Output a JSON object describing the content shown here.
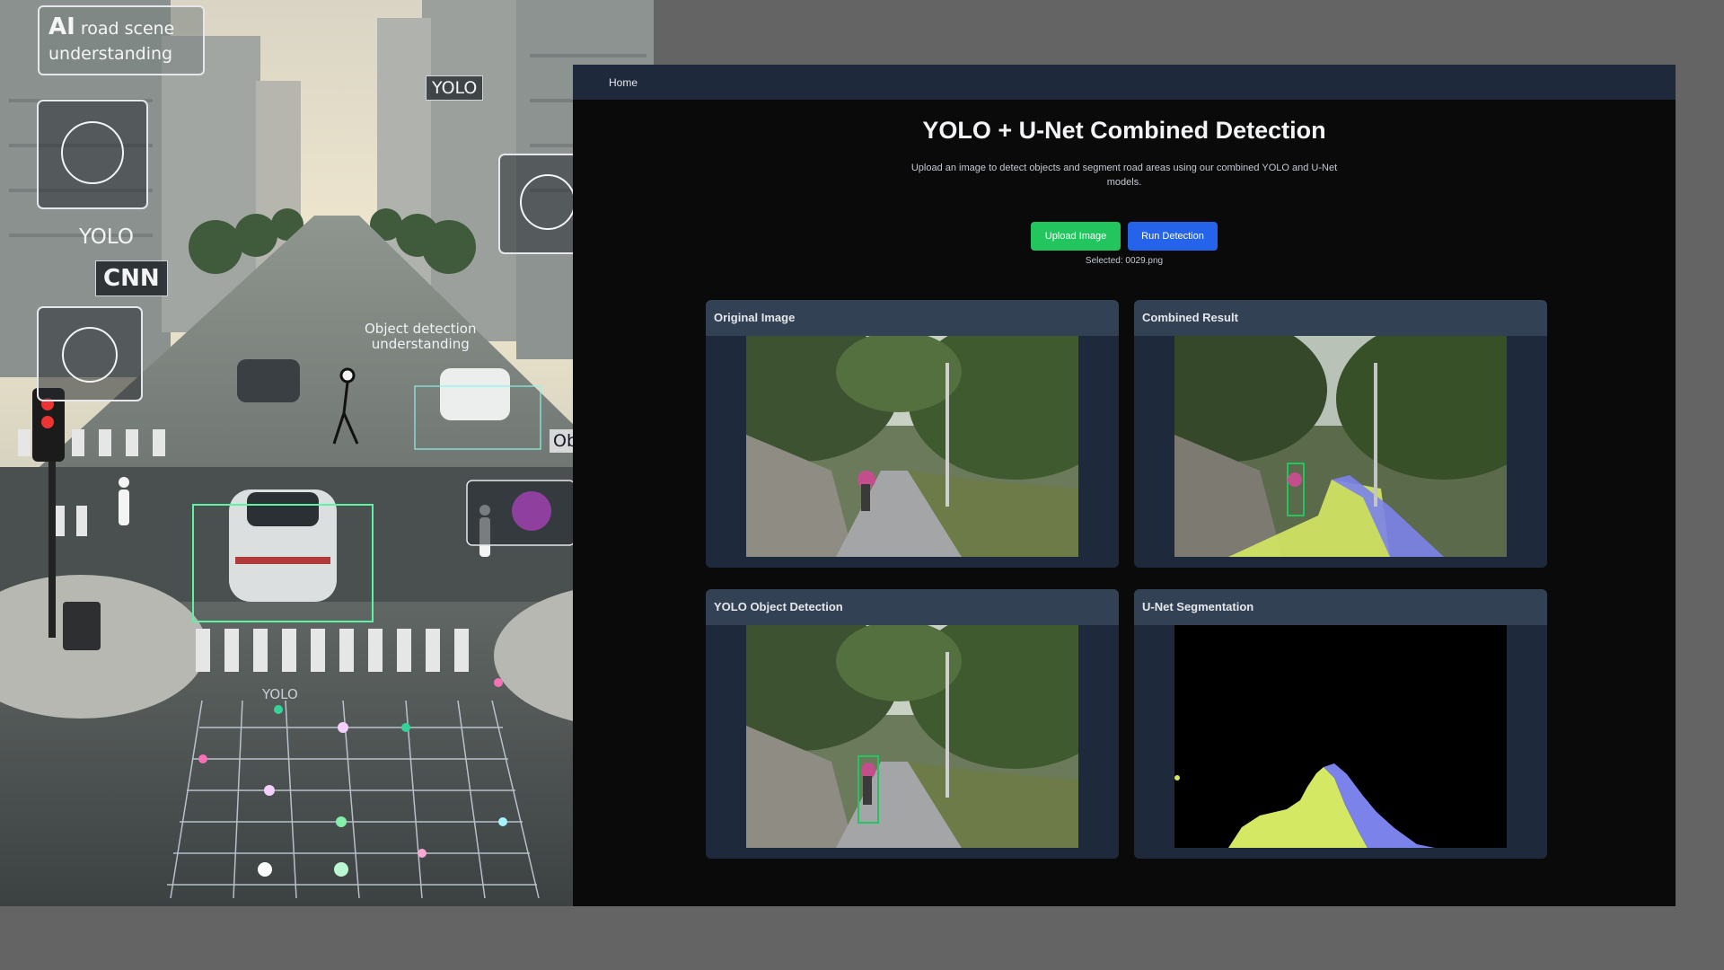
{
  "hero": {
    "title_ai": "AI",
    "title_rest": " road scene understanding",
    "yolo_left": "YOLO",
    "cnn": "CNN",
    "yolo_top": "YOLO",
    "object_caption": "Object detection\nunderstanding",
    "yolo_bottom": "YOLO",
    "obj_edge": "Obj"
  },
  "navbar": {
    "home_label": "Home"
  },
  "main": {
    "title": "YOLO + U-Net Combined Detection",
    "description": "Upload an image to detect objects and segment road areas using our combined YOLO and U-Net models."
  },
  "actions": {
    "upload_label": "Upload Image",
    "run_label": "Run Detection",
    "upload_color": "#22c55e",
    "run_color": "#2563eb"
  },
  "selected_file": "Selected: 0029.png",
  "cards": [
    {
      "title": "Original Image"
    },
    {
      "title": "Combined Result"
    },
    {
      "title": "YOLO Object Detection"
    },
    {
      "title": "U-Net Segmentation"
    }
  ],
  "colors": {
    "navbar": "#1e293b",
    "card_header": "#334155",
    "segmentation_road": "#7b83ea",
    "segmentation_sidewalk": "#d5e863",
    "detection_box": "#22c55e"
  }
}
